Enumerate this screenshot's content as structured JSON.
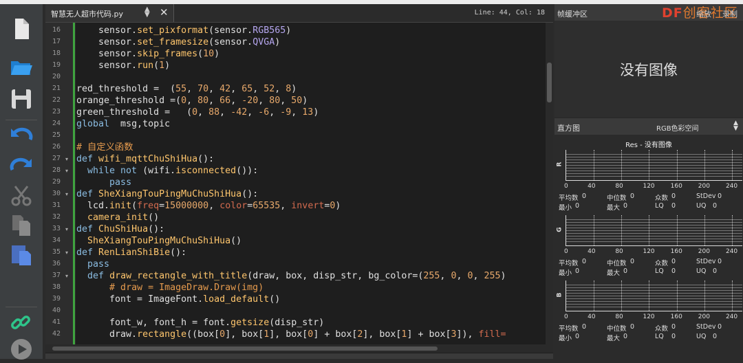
{
  "editor": {
    "tab_title": "智慧无人超市代码.py",
    "close": "✕",
    "line_col": "Line: 44, Col: 18",
    "lines": [
      {
        "n": 16,
        "fold": "",
        "t": [
          [
            "    sensor.",
            "#e0e0e0"
          ],
          [
            "set_pixformat",
            "#ffc66d"
          ],
          [
            "(sensor.",
            "#e0e0e0"
          ],
          [
            "RGB565",
            "#b6a7f0"
          ],
          [
            ")",
            "#e0e0e0"
          ]
        ]
      },
      {
        "n": 17,
        "fold": "",
        "t": [
          [
            "    sensor.",
            "#e0e0e0"
          ],
          [
            "set_framesize",
            "#ffc66d"
          ],
          [
            "(sensor.",
            "#e0e0e0"
          ],
          [
            "QVGA",
            "#b6a7f0"
          ],
          [
            ")",
            "#e0e0e0"
          ]
        ]
      },
      {
        "n": 18,
        "fold": "",
        "t": [
          [
            "    sensor.",
            "#e0e0e0"
          ],
          [
            "skip_frames",
            "#ffc66d"
          ],
          [
            "(",
            "#e0e0e0"
          ],
          [
            "10",
            "#e8a96b"
          ],
          [
            ")",
            "#e0e0e0"
          ]
        ]
      },
      {
        "n": 19,
        "fold": "",
        "t": [
          [
            "    sensor.",
            "#e0e0e0"
          ],
          [
            "run",
            "#ffc66d"
          ],
          [
            "(",
            "#e0e0e0"
          ],
          [
            "1",
            "#e8a96b"
          ],
          [
            ")",
            "#e0e0e0"
          ]
        ]
      },
      {
        "n": 20,
        "fold": "",
        "t": []
      },
      {
        "n": 21,
        "fold": "",
        "t": [
          [
            "red_threshold =  (",
            "#e0e0e0"
          ],
          [
            "55",
            "#e8a96b"
          ],
          [
            ", ",
            "#e0e0e0"
          ],
          [
            "70",
            "#e8a96b"
          ],
          [
            ", ",
            "#e0e0e0"
          ],
          [
            "42",
            "#e8a96b"
          ],
          [
            ", ",
            "#e0e0e0"
          ],
          [
            "65",
            "#e8a96b"
          ],
          [
            ", ",
            "#e0e0e0"
          ],
          [
            "52",
            "#e8a96b"
          ],
          [
            ", ",
            "#e0e0e0"
          ],
          [
            "8",
            "#e8a96b"
          ],
          [
            ")",
            "#e0e0e0"
          ]
        ]
      },
      {
        "n": 22,
        "fold": "",
        "t": [
          [
            "orange_threshold =(",
            "#e0e0e0"
          ],
          [
            "0",
            "#e8a96b"
          ],
          [
            ", ",
            "#e0e0e0"
          ],
          [
            "80",
            "#e8a96b"
          ],
          [
            ", ",
            "#e0e0e0"
          ],
          [
            "66",
            "#e8a96b"
          ],
          [
            ", ",
            "#e0e0e0"
          ],
          [
            "-20",
            "#e8a96b"
          ],
          [
            ", ",
            "#e0e0e0"
          ],
          [
            "80",
            "#e8a96b"
          ],
          [
            ", ",
            "#e0e0e0"
          ],
          [
            "50",
            "#e8a96b"
          ],
          [
            ")",
            "#e0e0e0"
          ]
        ]
      },
      {
        "n": 23,
        "fold": "",
        "t": [
          [
            "green_threshold =   (",
            "#e0e0e0"
          ],
          [
            "0",
            "#e8a96b"
          ],
          [
            ", ",
            "#e0e0e0"
          ],
          [
            "88",
            "#e8a96b"
          ],
          [
            ", ",
            "#e0e0e0"
          ],
          [
            "-42",
            "#e8a96b"
          ],
          [
            ", ",
            "#e0e0e0"
          ],
          [
            "-6",
            "#e8a96b"
          ],
          [
            ", ",
            "#e0e0e0"
          ],
          [
            "-9",
            "#e8a96b"
          ],
          [
            ", ",
            "#e0e0e0"
          ],
          [
            "13",
            "#e8a96b"
          ],
          [
            ")",
            "#e0e0e0"
          ]
        ]
      },
      {
        "n": 24,
        "fold": "",
        "t": [
          [
            "global",
            "#8bbde3"
          ],
          [
            "  msg,topic",
            "#e0e0e0"
          ]
        ]
      },
      {
        "n": 25,
        "fold": "",
        "t": []
      },
      {
        "n": 26,
        "fold": "",
        "t": [
          [
            "# 自定义函数",
            "#e69b4e"
          ]
        ]
      },
      {
        "n": 27,
        "fold": "▾",
        "t": [
          [
            "def",
            "#8bbde3"
          ],
          [
            " ",
            "#e0e0e0"
          ],
          [
            "wifi_mqttChuShiHua",
            "#ffc66d"
          ],
          [
            "():",
            "#e0e0e0"
          ]
        ]
      },
      {
        "n": 28,
        "fold": "▾",
        "t": [
          [
            "  ",
            "#e0e0e0"
          ],
          [
            "while not",
            "#8bbde3"
          ],
          [
            " (wifi.",
            "#e0e0e0"
          ],
          [
            "isconnected",
            "#ffc66d"
          ],
          [
            "()):",
            "#e0e0e0"
          ]
        ]
      },
      {
        "n": 29,
        "fold": "",
        "t": [
          [
            "      ",
            "#e0e0e0"
          ],
          [
            "pass",
            "#8bbde3"
          ]
        ]
      },
      {
        "n": 30,
        "fold": "▾",
        "t": [
          [
            "def",
            "#8bbde3"
          ],
          [
            " ",
            "#e0e0e0"
          ],
          [
            "SheXiangTouPingMuChuShiHua",
            "#ffc66d"
          ],
          [
            "():",
            "#e0e0e0"
          ]
        ]
      },
      {
        "n": 31,
        "fold": "",
        "t": [
          [
            "  lcd.",
            "#e0e0e0"
          ],
          [
            "init",
            "#ffc66d"
          ],
          [
            "(",
            "#e0e0e0"
          ],
          [
            "freq",
            "#d36b4f"
          ],
          [
            "=",
            "#e0e0e0"
          ],
          [
            "15000000",
            "#e8a96b"
          ],
          [
            ", ",
            "#e0e0e0"
          ],
          [
            "color",
            "#d36b4f"
          ],
          [
            "=",
            "#e0e0e0"
          ],
          [
            "65535",
            "#e8a96b"
          ],
          [
            ", ",
            "#e0e0e0"
          ],
          [
            "invert",
            "#d36b4f"
          ],
          [
            "=",
            "#e0e0e0"
          ],
          [
            "0",
            "#e8a96b"
          ],
          [
            ")",
            "#e0e0e0"
          ]
        ]
      },
      {
        "n": 32,
        "fold": "",
        "t": [
          [
            "  ",
            "#e0e0e0"
          ],
          [
            "camera_init",
            "#ffc66d"
          ],
          [
            "()",
            "#e0e0e0"
          ]
        ]
      },
      {
        "n": 33,
        "fold": "▾",
        "t": [
          [
            "def",
            "#8bbde3"
          ],
          [
            " ",
            "#e0e0e0"
          ],
          [
            "ChuShiHua",
            "#ffc66d"
          ],
          [
            "():",
            "#e0e0e0"
          ]
        ]
      },
      {
        "n": 34,
        "fold": "",
        "t": [
          [
            "  ",
            "#e0e0e0"
          ],
          [
            "SheXiangTouPingMuChuShiHua",
            "#ffc66d"
          ],
          [
            "()",
            "#e0e0e0"
          ]
        ]
      },
      {
        "n": 35,
        "fold": "▾",
        "t": [
          [
            "def",
            "#8bbde3"
          ],
          [
            " ",
            "#e0e0e0"
          ],
          [
            "RenLianShiBie",
            "#ffc66d"
          ],
          [
            "():",
            "#e0e0e0"
          ]
        ]
      },
      {
        "n": 36,
        "fold": "",
        "t": [
          [
            "  ",
            "#e0e0e0"
          ],
          [
            "pass",
            "#8bbde3"
          ]
        ]
      },
      {
        "n": 37,
        "fold": "▾",
        "t": [
          [
            "  ",
            "#e0e0e0"
          ],
          [
            "def",
            "#8bbde3"
          ],
          [
            " ",
            "#e0e0e0"
          ],
          [
            "draw_rectangle_with_title",
            "#ffc66d"
          ],
          [
            "(draw, box, disp_str, bg_color=(",
            "#e0e0e0"
          ],
          [
            "255",
            "#e8a96b"
          ],
          [
            ", ",
            "#e0e0e0"
          ],
          [
            "0",
            "#e8a96b"
          ],
          [
            ", ",
            "#e0e0e0"
          ],
          [
            "0",
            "#e8a96b"
          ],
          [
            ", ",
            "#e0e0e0"
          ],
          [
            "255",
            "#e8a96b"
          ],
          [
            ")",
            "#e0e0e0"
          ]
        ]
      },
      {
        "n": 38,
        "fold": "",
        "t": [
          [
            "      ",
            "#e0e0e0"
          ],
          [
            "# draw = ImageDraw.Draw(img)",
            "#e69b4e"
          ]
        ]
      },
      {
        "n": 39,
        "fold": "",
        "t": [
          [
            "      font = ImageFont.",
            "#e0e0e0"
          ],
          [
            "load_default",
            "#ffc66d"
          ],
          [
            "()",
            "#e0e0e0"
          ]
        ]
      },
      {
        "n": 40,
        "fold": "",
        "t": []
      },
      {
        "n": 41,
        "fold": "",
        "t": [
          [
            "      font_w, font_h = font.",
            "#e0e0e0"
          ],
          [
            "getsize",
            "#ffc66d"
          ],
          [
            "(disp_str)",
            "#e0e0e0"
          ]
        ]
      },
      {
        "n": 42,
        "fold": "",
        "t": [
          [
            "      draw.",
            "#e0e0e0"
          ],
          [
            "rectangle",
            "#ffc66d"
          ],
          [
            "((box[",
            "#e0e0e0"
          ],
          [
            "0",
            "#e8a96b"
          ],
          [
            "], box[",
            "#e0e0e0"
          ],
          [
            "1",
            "#e8a96b"
          ],
          [
            "], box[",
            "#e0e0e0"
          ],
          [
            "0",
            "#e8a96b"
          ],
          [
            "] + box[",
            "#e0e0e0"
          ],
          [
            "2",
            "#e8a96b"
          ],
          [
            "], box[",
            "#e0e0e0"
          ],
          [
            "1",
            "#e8a96b"
          ],
          [
            "] + box[",
            "#e0e0e0"
          ],
          [
            "3",
            "#e8a96b"
          ],
          [
            "]), ",
            "#e0e0e0"
          ],
          [
            "fill=",
            "#d36b4f"
          ]
        ]
      }
    ]
  },
  "framebuffer": {
    "title": "帧缓冲区",
    "zoom": "缩放",
    "record": "录制",
    "no_image": "没有图像",
    "logo_df": "DF",
    "logo_text": "创客社区"
  },
  "histogram": {
    "title": "直方图",
    "color_space": "RGB色彩空间",
    "res_title": "Res - 没有图像",
    "x_ticks": [
      "0",
      "40",
      "80",
      "120",
      "160",
      "200",
      "240"
    ],
    "stat_labels": {
      "mean": "平均数",
      "median": "中位数",
      "mode": "众数",
      "stdev": "StDev",
      "min": "最小",
      "max": "最大",
      "lq": "LQ",
      "uq": "UQ"
    },
    "channels": [
      {
        "label": "R",
        "mean": "0",
        "median": "0",
        "mode": "0",
        "stdev": "0",
        "min": "0",
        "max": "0",
        "lq": "0",
        "uq": "0"
      },
      {
        "label": "G",
        "mean": "0",
        "median": "0",
        "mode": "0",
        "stdev": "0",
        "min": "0",
        "max": "0",
        "lq": "0",
        "uq": "0"
      },
      {
        "label": "B",
        "mean": "0",
        "median": "0",
        "mode": "0",
        "stdev": "0",
        "min": "0",
        "max": "0",
        "lq": "0",
        "uq": "0"
      }
    ]
  },
  "colors": {
    "code_text": "#e0e0e0",
    "keyword": "#8bbde3",
    "function": "#ffc66d",
    "number": "#e8a96b",
    "comment": "#e69b4e",
    "param": "#d36b4f",
    "constant": "#b6a7f0",
    "change_bar": "#3fa33f"
  },
  "icons": [
    "new-file-icon",
    "open-folder-icon",
    "save-icon",
    "undo-icon",
    "redo-icon",
    "cut-icon",
    "copy-icon",
    "paste-icon",
    "connect-icon",
    "run-icon"
  ]
}
